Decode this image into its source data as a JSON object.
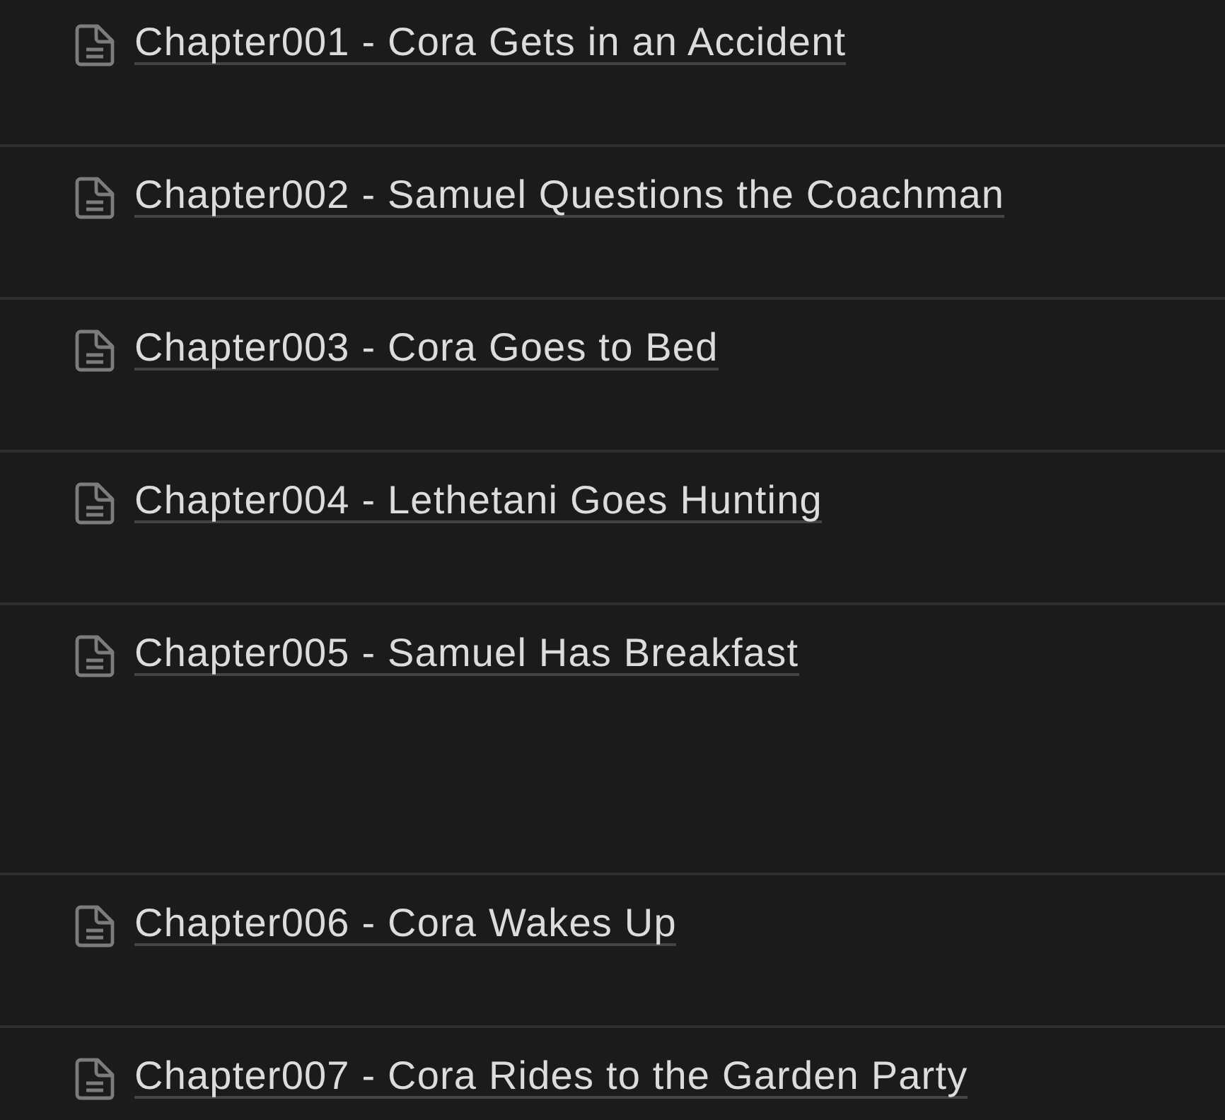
{
  "chapters": [
    {
      "title": "Chapter001 - Cora Gets in an Accident"
    },
    {
      "title": "Chapter002 - Samuel Questions the Coachman"
    },
    {
      "title": "Chapter003 - Cora Goes to Bed"
    },
    {
      "title": "Chapter004 - Lethetani Goes Hunting"
    },
    {
      "title": "Chapter005 - Samuel Has Breakfast"
    },
    {
      "title": "Chapter006 - Cora Wakes Up"
    },
    {
      "title": "Chapter007 - Cora Rides to the Garden Party"
    }
  ]
}
